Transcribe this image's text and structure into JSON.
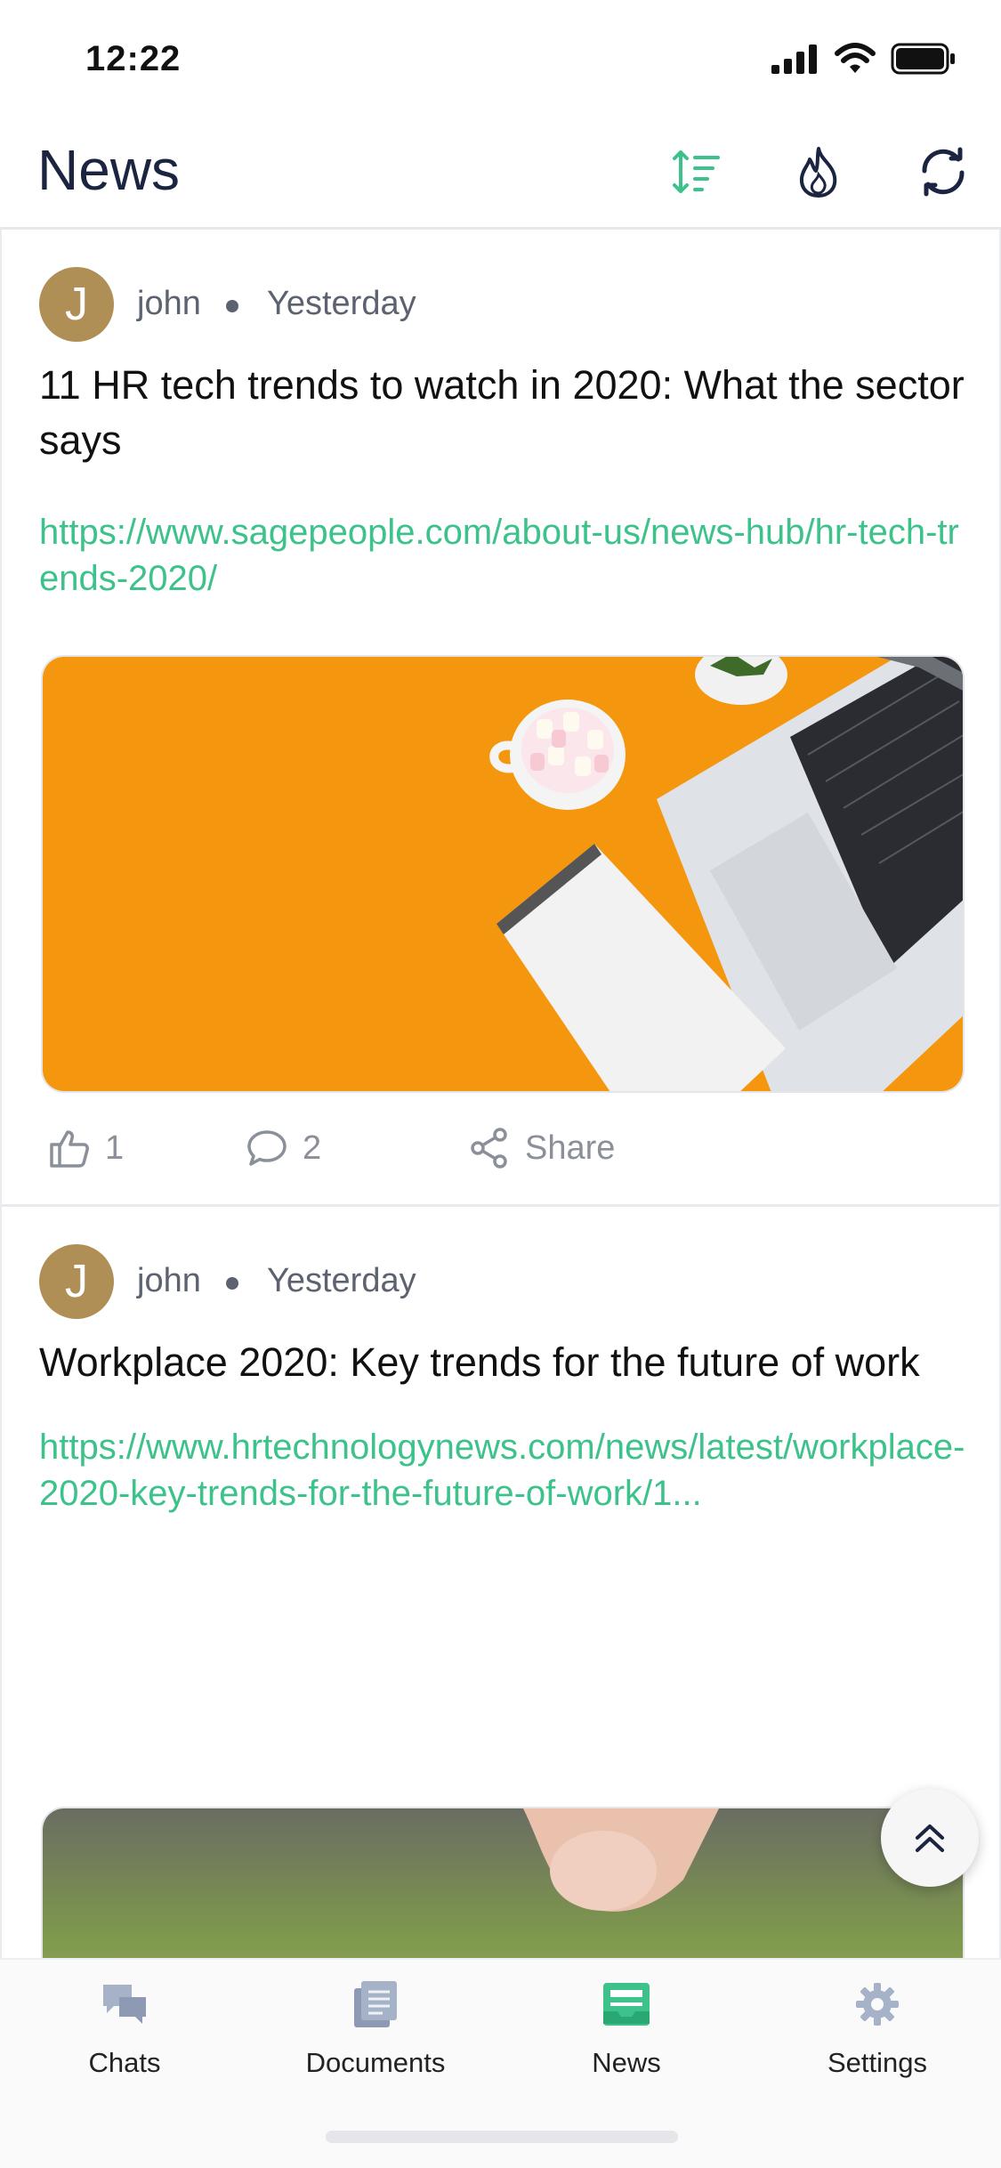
{
  "status_bar": {
    "time": "12:22"
  },
  "header": {
    "title": "News",
    "icons": [
      "sort-icon",
      "fire-icon",
      "refresh-icon"
    ],
    "accent_color": "#3cc28a"
  },
  "posts": [
    {
      "avatar_letter": "J",
      "author": "john",
      "time": "Yesterday",
      "title": "11 HR tech trends to watch in 2020: What the sector says",
      "link": "https://www.sagepeople.com/about-us/news-hub/hr-tech-trends-2020/",
      "image": "orange desk with laptop, notebook and cup of marshmallows",
      "likes": "1",
      "comments": "2",
      "share_label": "Share"
    },
    {
      "avatar_letter": "J",
      "author": "john",
      "time": "Yesterday",
      "title": "Workplace 2020: Key trends for the future of work",
      "link": "https://www.hrtechnologynews.com/news/latest/workplace-2020-key-trends-for-the-future-of-work/1...",
      "image": "hand turning dice from 2019 to 2020"
    }
  ],
  "tabs": [
    {
      "label": "Chats",
      "icon": "chats-icon"
    },
    {
      "label": "Documents",
      "icon": "documents-icon"
    },
    {
      "label": "News",
      "icon": "news-icon",
      "active": true
    },
    {
      "label": "Settings",
      "icon": "settings-icon"
    }
  ],
  "colors": {
    "link": "#3cc28a",
    "avatar": "#b08f56",
    "tab_inactive": "#a6b2c8",
    "tab_active": "#3cc28a"
  }
}
